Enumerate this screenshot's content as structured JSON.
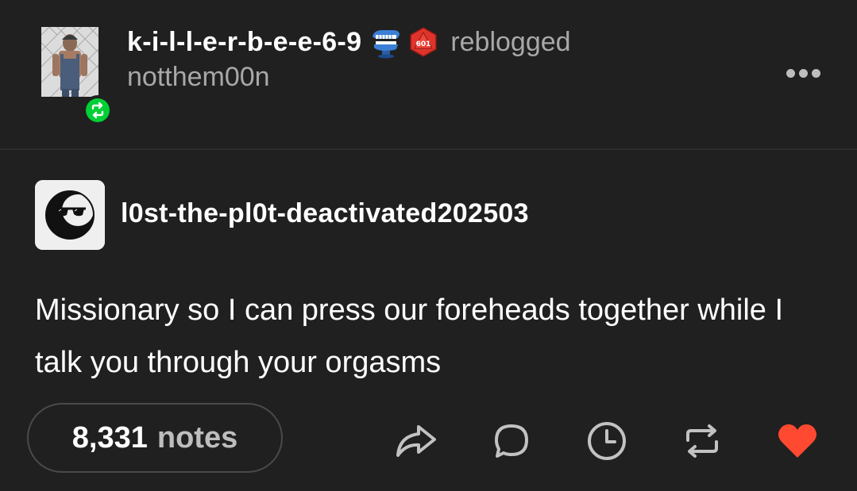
{
  "header": {
    "username": "k-i-l-l-e-r-b-e-e-6-9",
    "badges": [
      "chattering-teeth-badge-icon",
      "d20-die-badge-icon"
    ],
    "d20_label": "601",
    "action_text": "reblogged",
    "from_user": "notthem00n"
  },
  "trail": {
    "username": "l0st-the-pl0t-deactivated202503",
    "text": "Missionary so I can press our foreheads together while I talk you through your orgasms"
  },
  "footer": {
    "notes_count": "8,331",
    "notes_label": "notes",
    "actions": [
      "share-icon",
      "reply-icon",
      "queue-icon",
      "reblog-icon",
      "like-icon"
    ]
  },
  "colors": {
    "background": "#202020",
    "reblog_green": "#00cf35",
    "like_red": "#ff4930",
    "muted_text": "#a8a8a8"
  }
}
